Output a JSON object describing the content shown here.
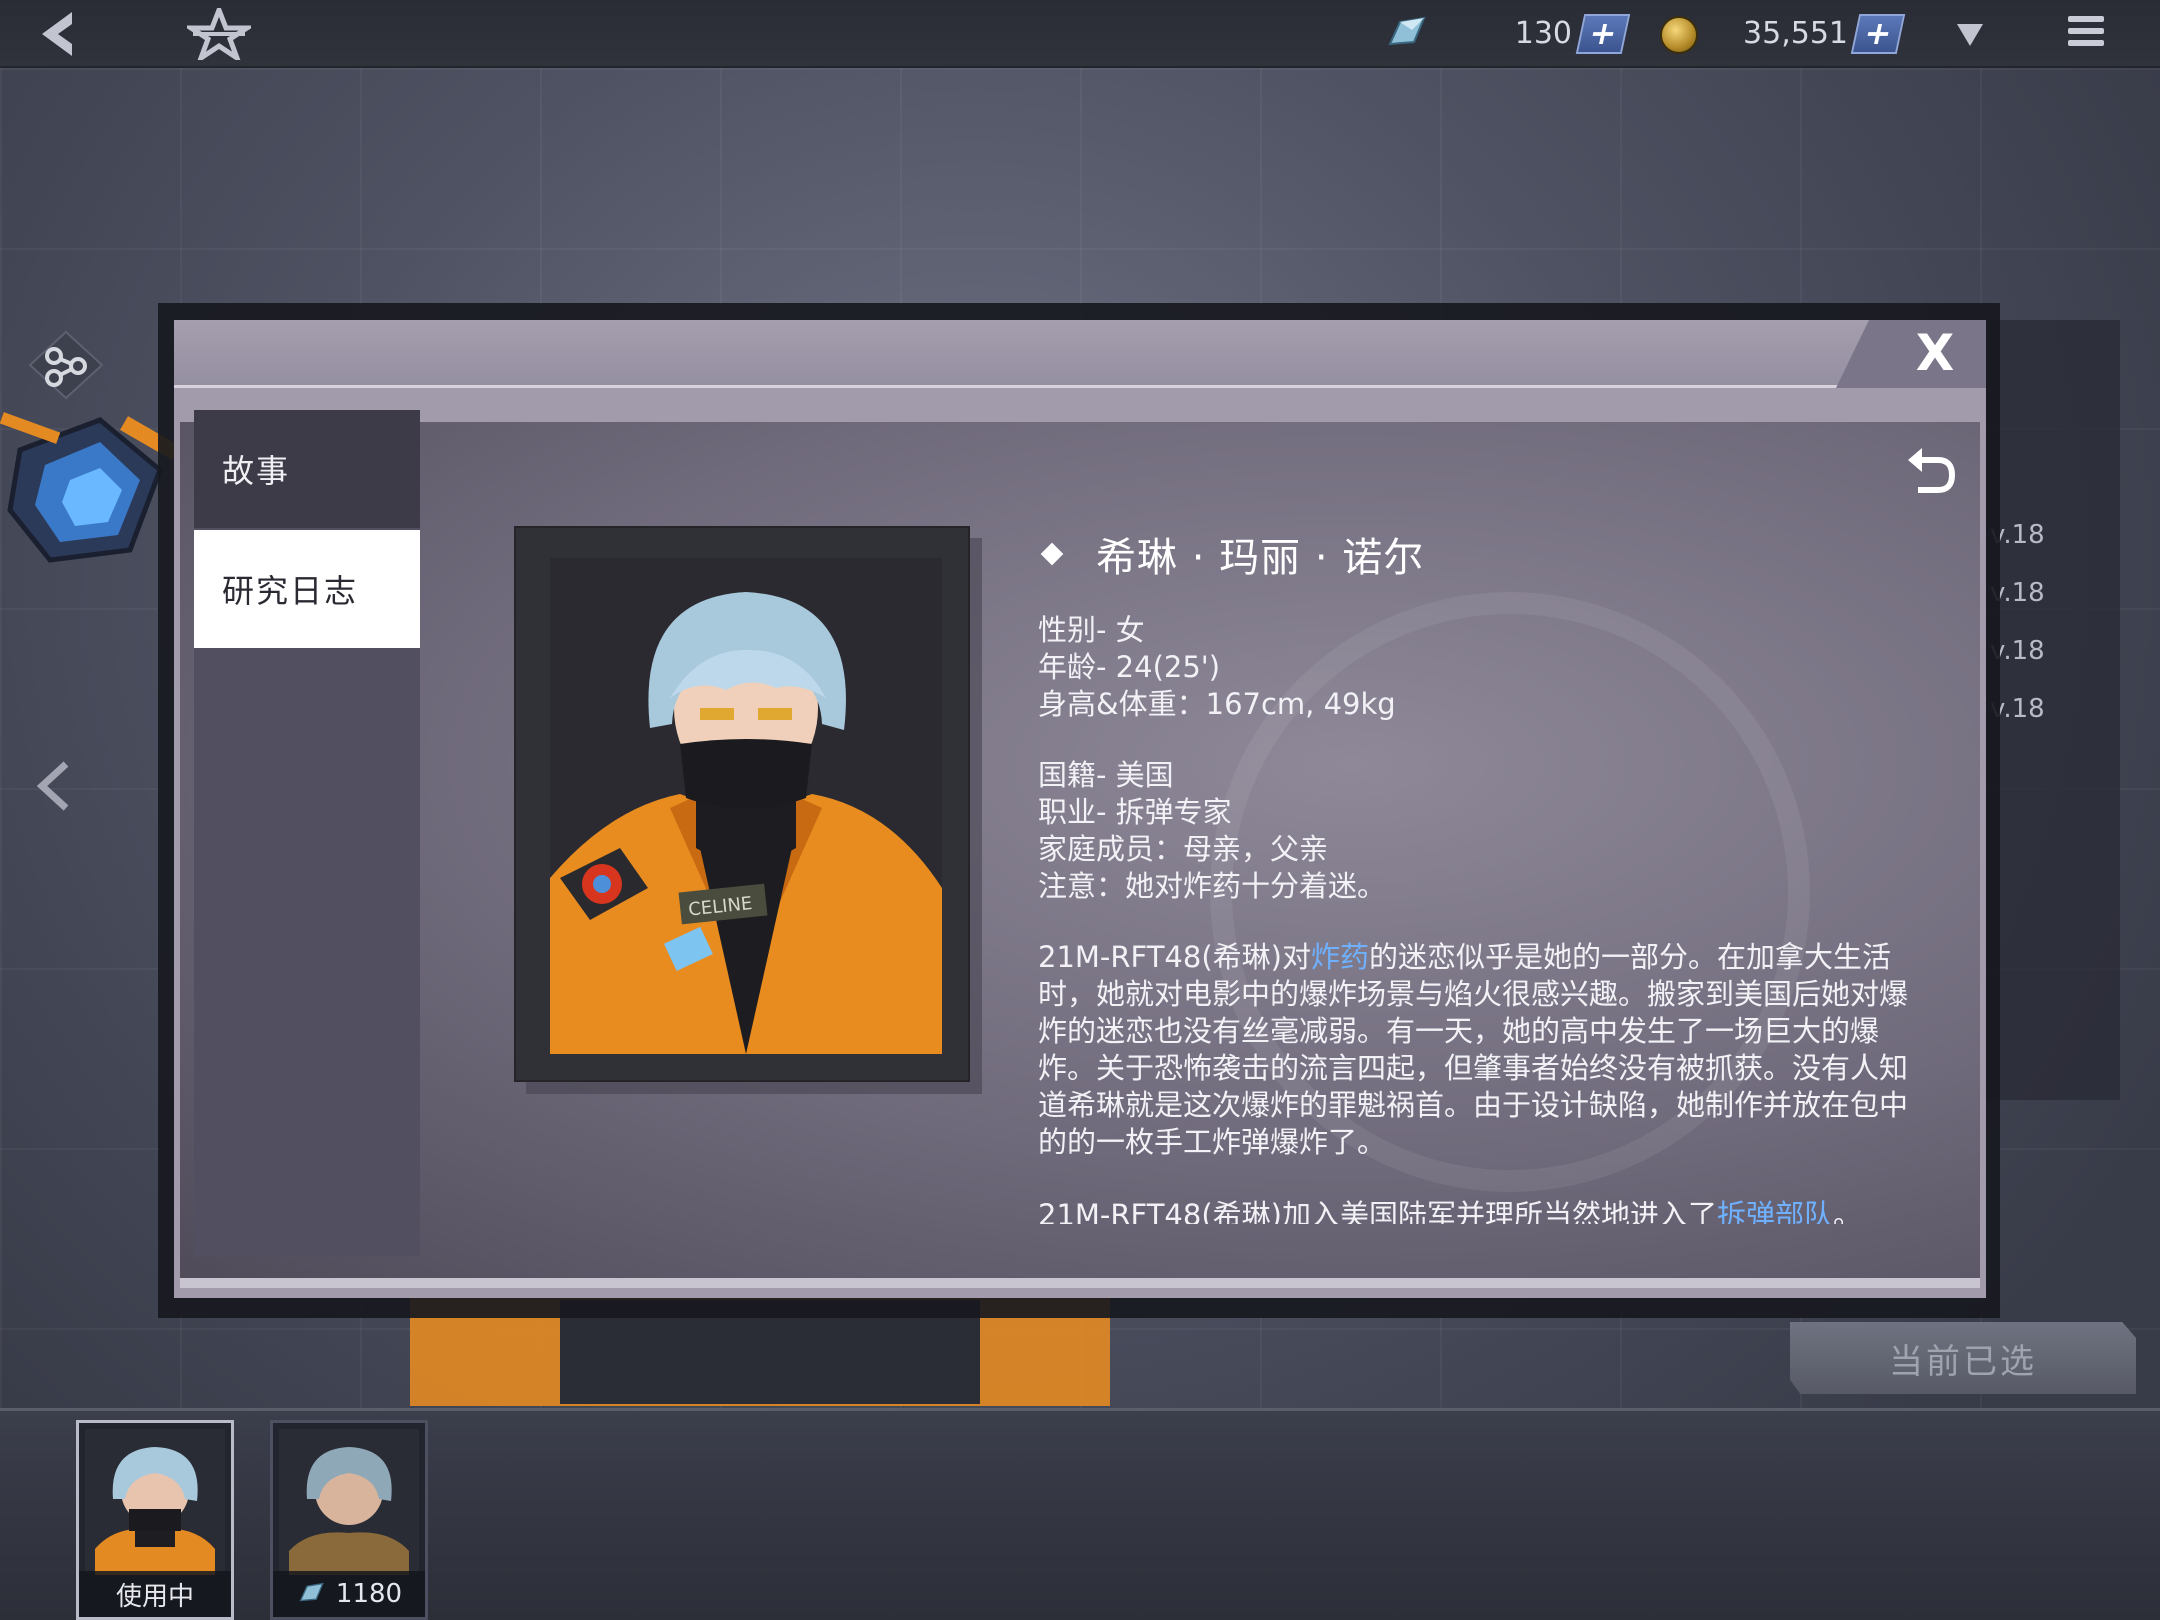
{
  "topbar": {
    "crystal_count": "130",
    "coin_count": "35,551",
    "plus_label": "+"
  },
  "background": {
    "level_labels": [
      "v.18",
      "v.18",
      "v.18",
      "v.18"
    ],
    "current_selected_label": "当前已选"
  },
  "dialog": {
    "close_label": "X",
    "tabs": [
      {
        "label": "故事",
        "active": false
      },
      {
        "label": "研究日志",
        "active": true
      }
    ],
    "character": {
      "name": "希琳 · 玛丽 · 诺尔",
      "badge_text": "CELINE"
    },
    "profile_lines_1": [
      "性别- 女",
      "年龄- 24(25')",
      "身高&体重：167cm, 49kg"
    ],
    "profile_lines_2": [
      "国籍- 美国",
      "职业- 拆弹专家",
      "家庭成员：母亲，父亲",
      "注意：她对炸药十分着迷。"
    ],
    "story_para_1": {
      "pre": "21M-RFT48(希琳)对",
      "link": "炸药",
      "post": "的迷恋似乎是她的一部分。在加拿大生活时，她就对电影中的爆炸场景与焰火很感兴趣。搬家到美国后她对爆炸的迷恋也没有丝毫减弱。有一天，她的高中发生了一场巨大的爆炸。关于恐怖袭击的流言四起，但肇事者始终没有被抓获。没有人知道希琳就是这次爆炸的罪魁祸首。由于设计缺陷，她制作并放在包中的的一枚手工炸弹爆炸了。"
    },
    "story_para_2": {
      "pre": "21M-RFT48(希琳)加入美国陆军并理所当然地进入了",
      "link": "拆弹部队",
      "post": "。"
    }
  },
  "bottom_strip": {
    "thumb1_label": "使用中",
    "thumb2_cost": "1180"
  },
  "colors": {
    "accent_blue": "#6fb0ff",
    "jacket_orange": "#e48a22",
    "hair_blue": "#a8c8dc"
  }
}
